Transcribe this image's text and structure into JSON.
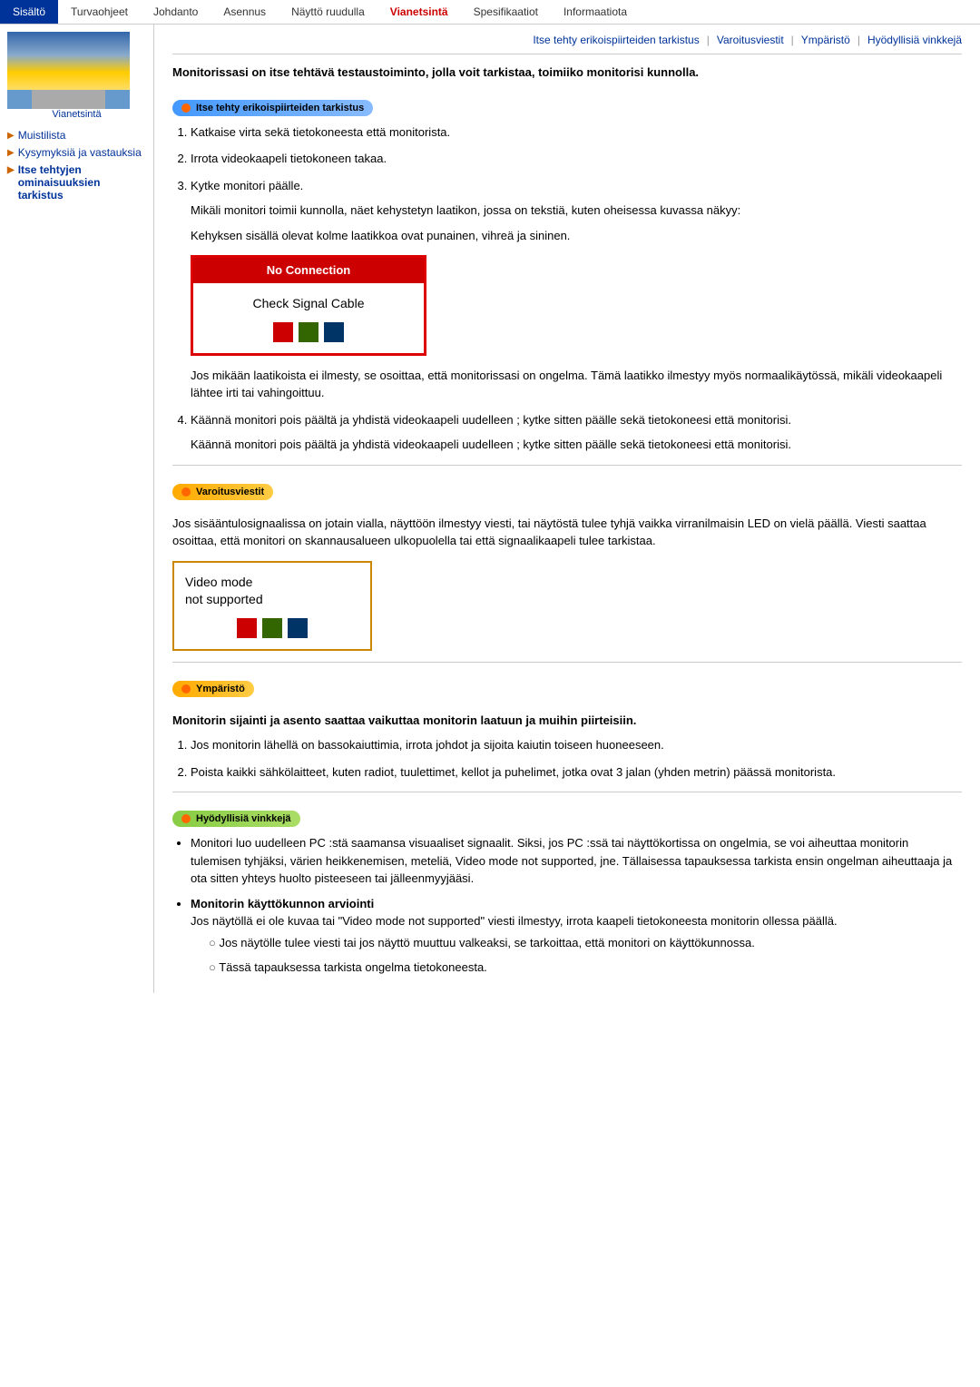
{
  "nav": {
    "items": [
      {
        "label": "Sisältö",
        "active": true
      },
      {
        "label": "Turvaohjeet",
        "active": false
      },
      {
        "label": "Johdanto",
        "active": false
      },
      {
        "label": "Asennus",
        "active": false
      },
      {
        "label": "Näyttö ruudulla",
        "active": false
      },
      {
        "label": "Vianetsintä",
        "current": true
      },
      {
        "label": "Spesifikaatiot",
        "active": false
      },
      {
        "label": "Informaatiota",
        "active": false
      }
    ]
  },
  "sidebar": {
    "label": "Vianetsintä",
    "links": [
      {
        "text": "Muistilista",
        "arrow": "▶"
      },
      {
        "text": "Kysymyksiä ja vastauksia",
        "arrow": "▶"
      },
      {
        "text": "Itse tehtyjen ominaisuuksien tarkistus",
        "arrow": "▶",
        "active": true
      }
    ]
  },
  "subnav": {
    "links": [
      "Itse tehty erikoispiirteiden tarkistus",
      "Varoitusviestit",
      "Ympäristö",
      "Hyödyllisiä vinkkejä"
    ]
  },
  "sections": {
    "intro": "Monitorissasi on itse tehtävä testaustoiminto, jolla voit tarkistaa, toimiiko monitorisi kunnolla.",
    "section1_btn": "Itse tehty erikoispiirteiden tarkistus",
    "steps": [
      "Katkaise virta sekä tietokoneesta että monitorista.",
      "Irrota videokaapeli tietokoneen takaa.",
      "Kytke monitori päälle.",
      "Käännä monitori pois päältä ja yhdistä videokaapeli uudelleen ; kytke sitten päälle sekä tietokoneesi että monitorisi."
    ],
    "step3_para1": "Mikäli monitori toimii kunnolla, näet kehystetyn laatikon, jossa on tekstiä, kuten oheisessa kuvassa näkyy:",
    "step3_para2": "Kehyksen sisällä olevat kolme laatikkoa ovat punainen, vihreä ja sininen.",
    "no_connection": "No Connection",
    "check_signal": "Check Signal Cable",
    "step3_note": "Jos mikään laatikoista ei ilmesty, se osoittaa, että monitorissasi on ongelma. Tämä laatikko ilmestyy myös normaalikäytössä, mikäli videokaapeli lähtee irti tai vahingoittuu.",
    "step4_repeat": "Käännä monitori pois päältä ja yhdistä videokaapeli uudelleen ; kytke sitten päälle sekä tietokoneesi että monitorisi.",
    "section2_btn": "Varoitusviestit",
    "warning_para": "Jos sisääntulosignaalissa on jotain vialla, näyttöön ilmestyy viesti, tai näytöstä tulee tyhjä vaikka virranilmaisin LED on vielä päällä.\nViesti saattaa osoittaa, että monitori on skannausalueen ulkopuolella tai että signaalikaapeli tulee tarkistaa.",
    "video_mode_line1": "Video mode",
    "video_mode_line2": "     not supported",
    "section3_btn": "Ympäristö",
    "env_heading": "Monitorin sijainti ja asento saattaa vaikuttaa monitorin laatuun ja muihin piirteisiin.",
    "env_steps": [
      "Jos monitorin lähellä on bassokaiuttimia, irrota johdot ja sijoita kaiutin toiseen huoneeseen.",
      "Poista kaikki sähkölaitteet, kuten radiot, tuulettimet, kellot ja puhelimet, jotka ovat 3 jalan (yhden metrin) päässä monitorista."
    ],
    "section4_btn": "Hyödyllisiä vinkkejä",
    "tips_bullet1": "Monitori luo uudelleen PC :stä saamansa visuaaliset signaalit. Siksi, jos PC :ssä tai näyttökortissa on ongelmia, se voi aiheuttaa monitorin tulemisen tyhjäksi, värien heikkenemisen, meteliä, Video mode not supported, jne. Tällaisessa tapauksessa tarkista ensin ongelman aiheuttaaja ja ota sitten yhteys huolto pisteeseen tai jälleenmyyjääsi.",
    "tips_bullet2_heading": "Monitorin käyttökunnon arviointi",
    "tips_bullet2_para": "Jos näytöllä ei ole kuvaa tai \"Video mode not supported\" viesti ilmestyy, irrota kaapeli tietokoneesta monitorin ollessa päällä.",
    "tips_subbullets": [
      "Jos näytölle tulee viesti tai jos näyttö muuttuu valkeaksi, se tarkoittaa, että monitori on käyttökunnossa.",
      "Tässä tapauksessa tarkista ongelma tietokoneesta."
    ]
  }
}
